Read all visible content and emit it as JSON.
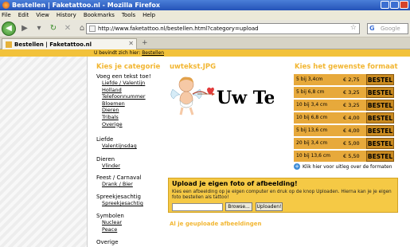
{
  "window": {
    "title": "Bestellen | Faketattoo.nl - Mozilla Firefox"
  },
  "menu": [
    "File",
    "Edit",
    "View",
    "History",
    "Bookmarks",
    "Tools",
    "Help"
  ],
  "nav": {
    "url": "http://www.faketattoo.nl/bestellen.html?category=upload",
    "search_placeholder": "Google"
  },
  "tab": {
    "title": "Bestellen | Faketattoo.nl"
  },
  "breadcrumb": {
    "prefix": "U bevindt zich hier:",
    "current": "Bestellen"
  },
  "categories": {
    "heading": "Kies je categorie",
    "groups": [
      {
        "title": "Voeg een tekst toe!",
        "items": [
          "Liefde / Valentijn",
          "Holland",
          "Telefoonnummer",
          "Bloemen",
          "Dieren",
          "Tribals",
          "Overige"
        ]
      },
      {
        "title": "Liefde",
        "items": [
          "Valentijnsdag"
        ]
      },
      {
        "title": "Dieren",
        "items": [
          "Vlinder"
        ]
      },
      {
        "title": "Feest / Carnaval",
        "items": [
          "Drank / Bier"
        ]
      },
      {
        "title": "Spreekjesachtig",
        "items": [
          "Spreekjesachtig"
        ]
      },
      {
        "title": "Symbolen",
        "items": [
          "Nuclear",
          "Peace"
        ]
      },
      {
        "title": "Overige",
        "items": []
      }
    ]
  },
  "product": {
    "filename": "uwtekst.JPG",
    "image_text": "Uw Tekst"
  },
  "formats": {
    "heading": "Kies het gewenste formaat",
    "button_label": "BESTEL",
    "rows": [
      {
        "size": "5 bij 3,4cm",
        "price": "€ 2,75"
      },
      {
        "size": "5 bij 6,8 cm",
        "price": "€ 3,25"
      },
      {
        "size": "10 bij 3,4 cm",
        "price": "€ 3,25"
      },
      {
        "size": "10 bij 6,8 cm",
        "price": "€ 4,00"
      },
      {
        "size": "5 bij 13,6 cm",
        "price": "€ 4,00"
      },
      {
        "size": "20 bij 3,4 cm",
        "price": "€ 5,00"
      },
      {
        "size": "10 bij 13,6 cm",
        "price": "€ 5,50"
      }
    ],
    "help_text": "Klik hier voor uitleg over de formaten"
  },
  "upload": {
    "title": "Upload je eigen foto of afbeelding!",
    "description": "Kies een afbeelding op je eigen computer en druk op de knop Uploaden. Hierna kan je je eigen foto bestellen als tattoo!",
    "browse_label": "Browse...",
    "submit_label": "Uploaden!",
    "uploaded_heading": "Al je geuploade afbeeldingen"
  },
  "colors": {
    "accent": "#f2b632",
    "button": "#c98a20",
    "row": "#e7a93b",
    "upload_bg": "#f5c945"
  }
}
